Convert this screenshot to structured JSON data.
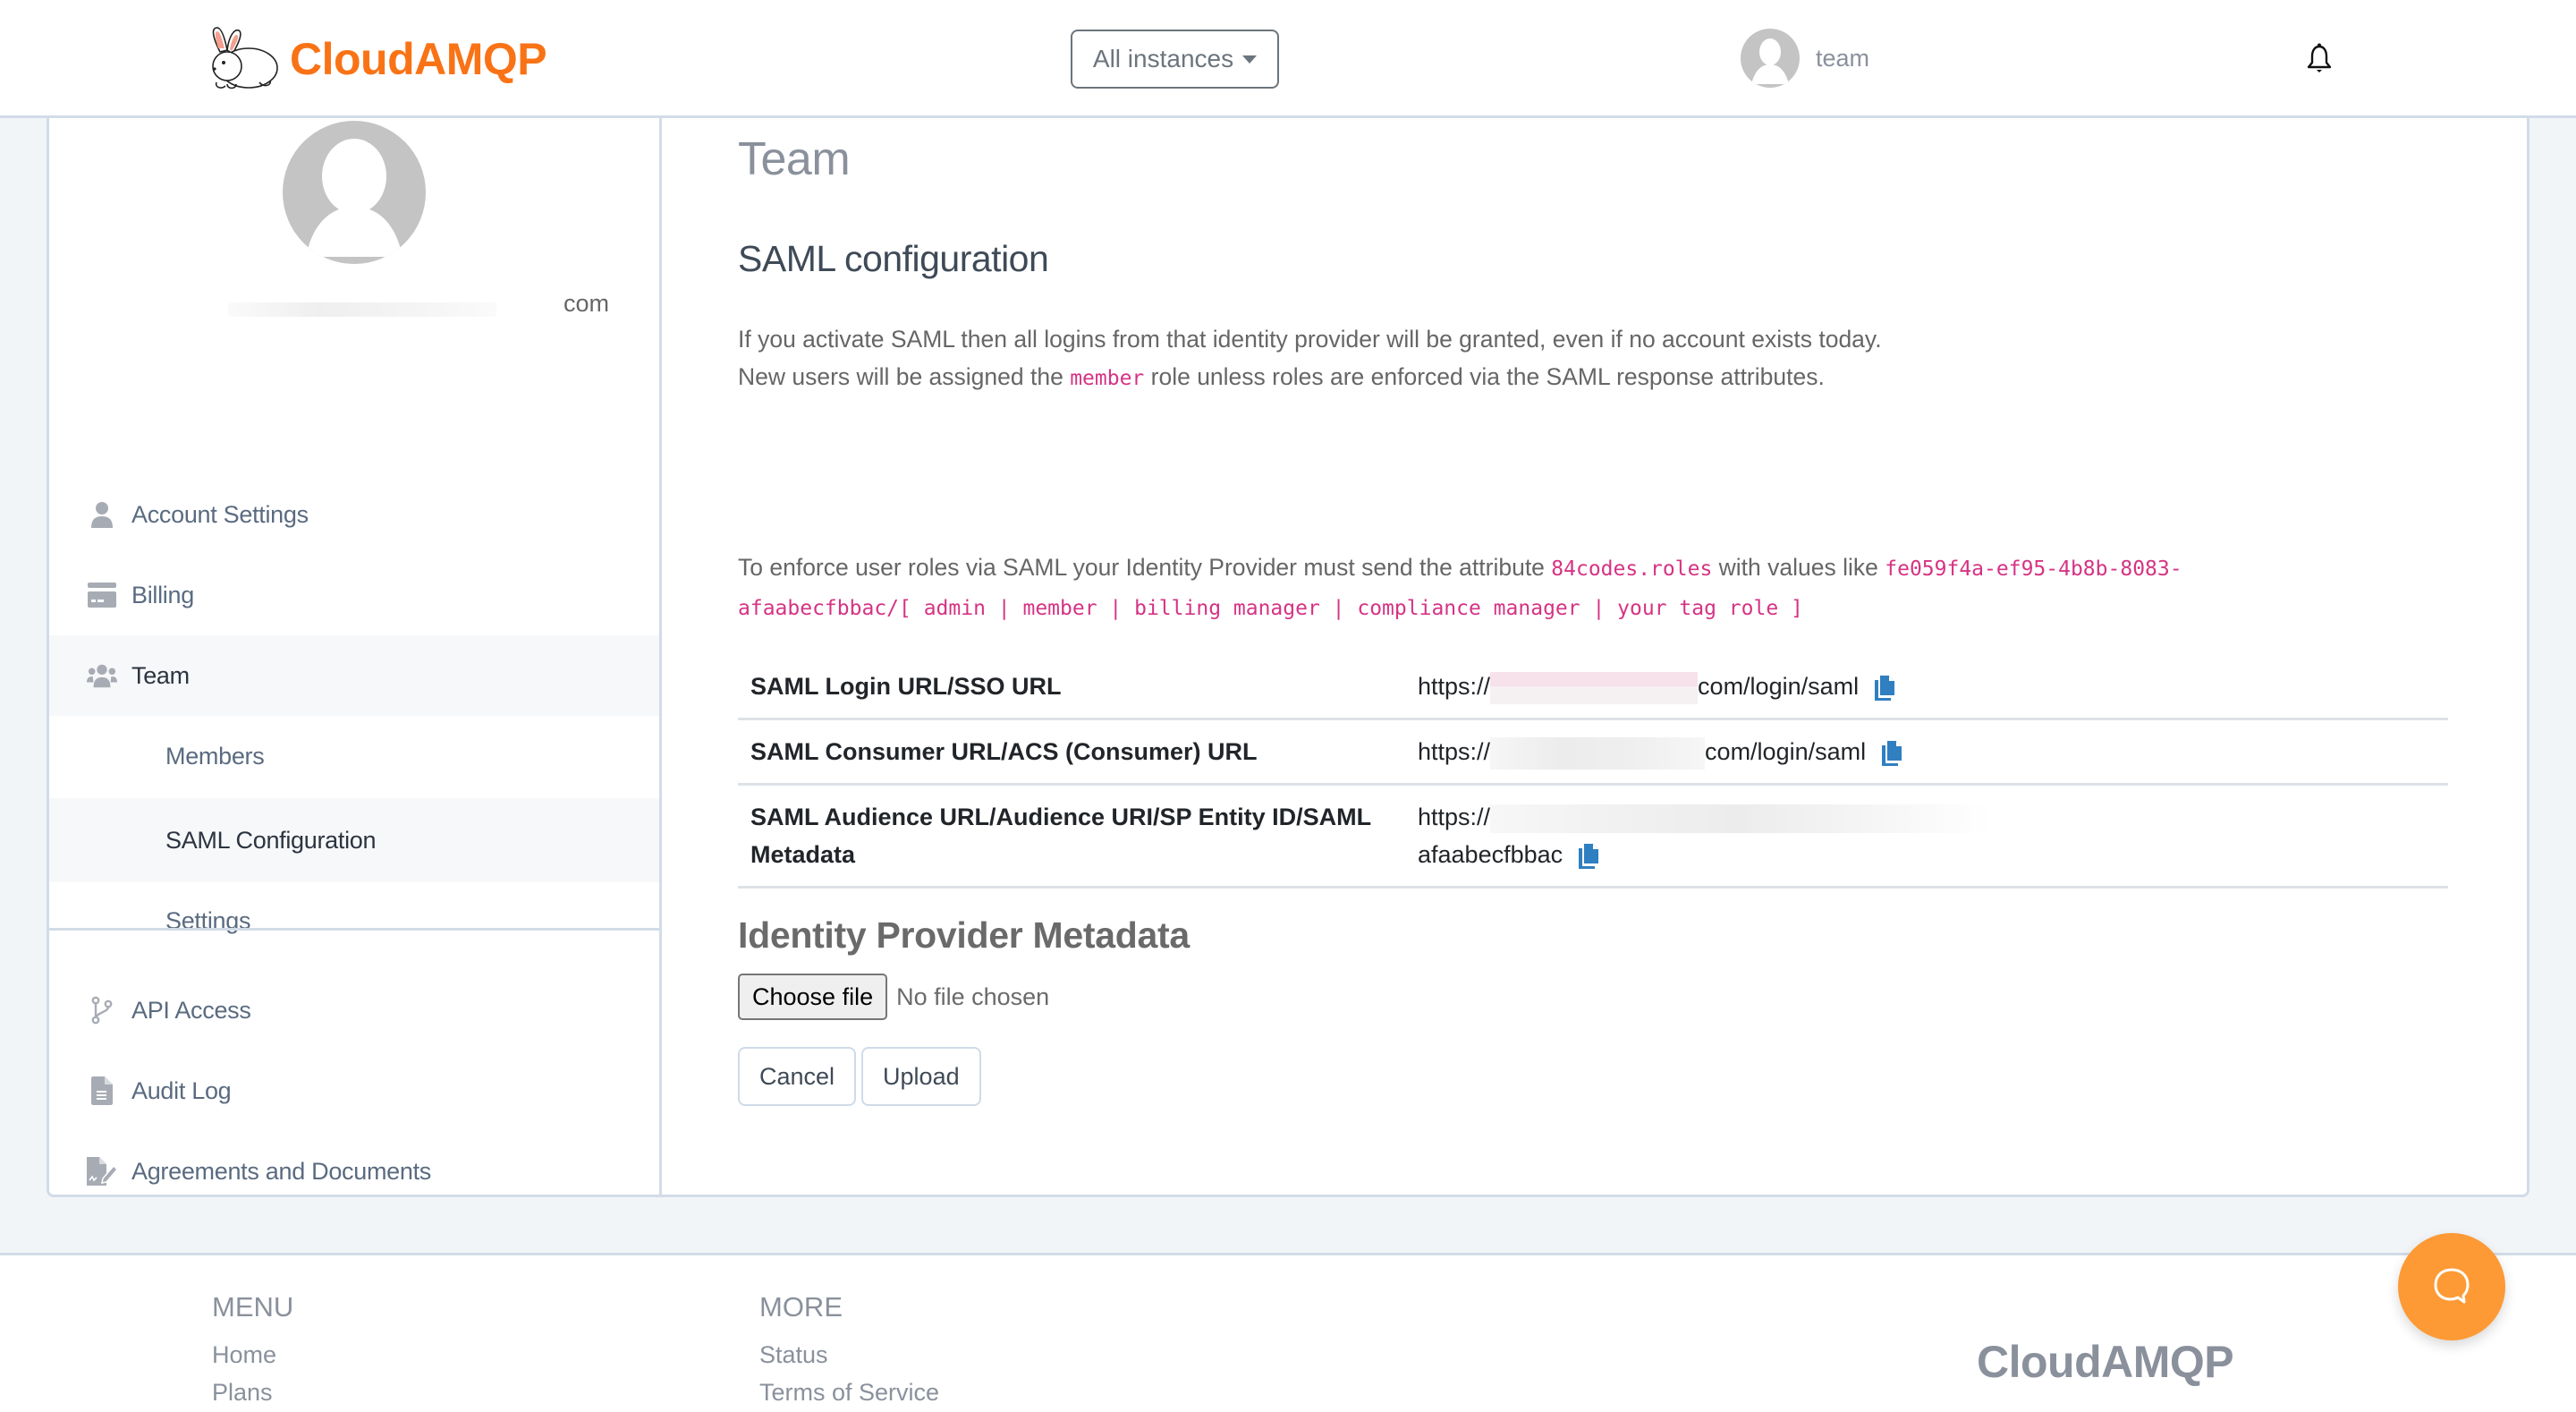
{
  "header": {
    "brand": "CloudAMQP",
    "instances_dropdown": "All instances",
    "user_label": "team",
    "notifications_icon": "bell-icon"
  },
  "sidebar": {
    "email_suffix": "com",
    "items": [
      {
        "label": "Account Settings",
        "icon": "user-icon"
      },
      {
        "label": "Billing",
        "icon": "credit-card-icon"
      },
      {
        "label": "Team",
        "icon": "users-icon"
      },
      {
        "label": "Members",
        "icon": ""
      },
      {
        "label": "SAML Configuration",
        "icon": ""
      },
      {
        "label": "Settings",
        "icon": ""
      },
      {
        "label": "API Access",
        "icon": "code-branch-icon"
      },
      {
        "label": "Audit Log",
        "icon": "file-icon"
      },
      {
        "label": "Agreements and Documents",
        "icon": "file-signature-icon"
      }
    ],
    "active_item": "SAML Configuration"
  },
  "main": {
    "page_title": "Team",
    "section_title": "SAML configuration",
    "intro_line1": "If you activate SAML then all logins from that identity provider will be granted, even if no account exists today.",
    "intro_line2_prefix": "New users will be assigned the ",
    "intro_line2_code": "member",
    "intro_line2_suffix": " role unless roles are enforced via the SAML response attributes.",
    "roles_prefix": "To enforce user roles via SAML your Identity Provider must send the attribute ",
    "roles_attr_code": "84codes.roles",
    "roles_middle": " with values like ",
    "roles_values_code_line1": "fe059f4a-ef95-4b8b-8083-",
    "roles_values_code_line2": "afaabecfbbac/[ admin | member | billing manager | compliance manager | your tag role ]",
    "saml_rows": [
      {
        "key": "SAML Login URL/SSO URL",
        "value_prefix": "https://",
        "value_suffix": "com/login/saml"
      },
      {
        "key": "SAML Consumer URL/ACS (Consumer) URL",
        "value_prefix": "https://",
        "value_suffix": "com/login/saml"
      },
      {
        "key": "SAML Audience URL/Audience URI/SP Entity ID/SAML Metadata",
        "value_prefix": "https://",
        "value_suffix": "afaabecfbbac"
      }
    ],
    "metadata_title": "Identity Provider Metadata",
    "choose_file_label": "Choose file",
    "file_status": "No file chosen",
    "cancel_label": "Cancel",
    "upload_label": "Upload"
  },
  "footer": {
    "menu_heading": "MENU",
    "menu_links": [
      "Home",
      "Plans"
    ],
    "more_heading": "MORE",
    "more_links": [
      "Status",
      "Terms of Service"
    ],
    "brand": "CloudAMQP"
  },
  "colors": {
    "brand_orange": "#f97316",
    "chat_orange": "#fd9a35",
    "code_pink": "#d63384",
    "copy_blue": "#2f7fc1",
    "border": "#d2dce8",
    "background": "#f2f5f8"
  }
}
